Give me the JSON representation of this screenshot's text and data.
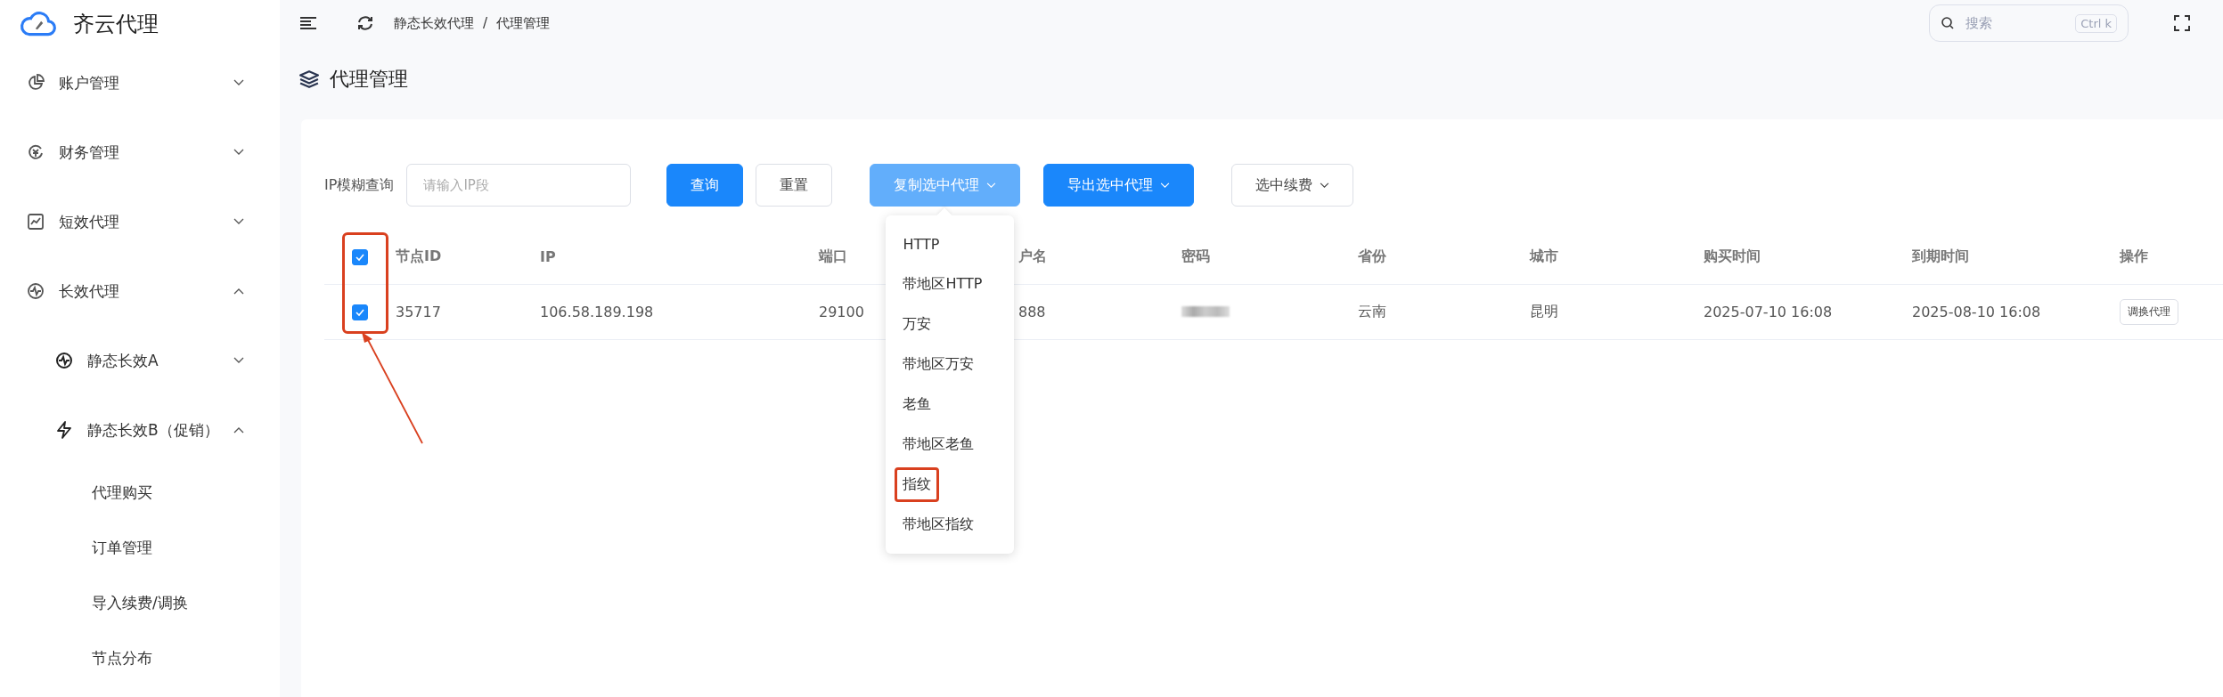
{
  "brand": {
    "name": "齐云代理"
  },
  "sidebar": {
    "items": [
      {
        "label": "账户管理",
        "expanded": false
      },
      {
        "label": "财务管理",
        "expanded": false
      },
      {
        "label": "短效代理",
        "expanded": false
      },
      {
        "label": "长效代理",
        "expanded": true,
        "children": [
          {
            "label": "静态长效A",
            "expanded": false
          },
          {
            "label": "静态长效B（促销）",
            "expanded": true,
            "children": [
              {
                "label": "代理购买"
              },
              {
                "label": "订单管理"
              },
              {
                "label": "导入续费/调换"
              },
              {
                "label": "节点分布"
              }
            ]
          }
        ]
      }
    ]
  },
  "breadcrumb": [
    "静态长效代理",
    "代理管理"
  ],
  "breadcrumb_separator": "/",
  "search": {
    "placeholder": "搜索",
    "shortcut": "Ctrl k"
  },
  "page_title": "代理管理",
  "filter": {
    "label": "IP模糊查询",
    "placeholder": "请输入IP段"
  },
  "buttons": [
    {
      "label": "查询",
      "kind": "primary",
      "dropdown": false,
      "open": false
    },
    {
      "label": "重置",
      "kind": "plain",
      "dropdown": false,
      "open": false
    },
    {
      "label": "复制选中代理",
      "kind": "primary",
      "dropdown": true,
      "open": true
    },
    {
      "label": "导出选中代理",
      "kind": "primary",
      "dropdown": true,
      "open": false
    },
    {
      "label": "选中续费",
      "kind": "plain",
      "dropdown": true,
      "open": false
    }
  ],
  "copy_menu": [
    {
      "label": "HTTP",
      "highlighted": false
    },
    {
      "label": "带地区HTTP",
      "highlighted": false
    },
    {
      "label": "万安",
      "highlighted": false
    },
    {
      "label": "带地区万安",
      "highlighted": false
    },
    {
      "label": "老鱼",
      "highlighted": false
    },
    {
      "label": "带地区老鱼",
      "highlighted": false
    },
    {
      "label": "指纹",
      "highlighted": true
    },
    {
      "label": "带地区指纹",
      "highlighted": false
    }
  ],
  "table": {
    "select_all_checked": true,
    "select_column_highlighted": true,
    "columns": [
      "节点ID",
      "IP",
      "端口",
      "户名",
      "密码",
      "省份",
      "城市",
      "购买时间",
      "到期时间",
      "操作"
    ],
    "rows": [
      {
        "checked": true,
        "node_id": "35717",
        "ip": "106.58.189.198",
        "port": "29100",
        "username": "888",
        "password_blurred": true,
        "province": "云南",
        "city": "昆明",
        "purchase_time": "2025-07-10 16:08",
        "expire_time": "2025-08-10 16:08",
        "action": "调换代理"
      }
    ]
  }
}
